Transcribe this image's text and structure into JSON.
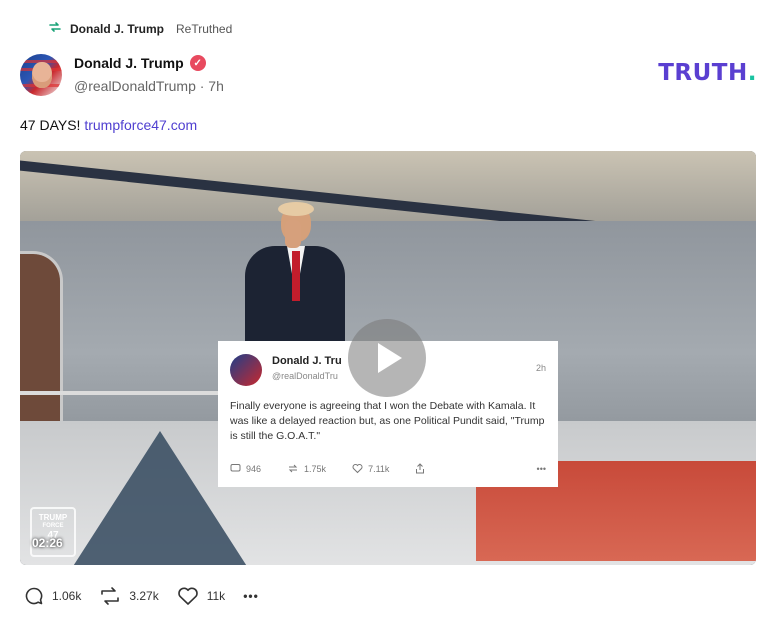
{
  "retruth": {
    "name": "Donald J. Trump",
    "label": "ReTruthed"
  },
  "author": {
    "display_name": "Donald J. Trump",
    "handle": "@realDonaldTrump · 7h"
  },
  "brand": {
    "logo_text": "TRUTH",
    "logo_dot": ".",
    "accent": "#5a3fd1",
    "dot_color": "#19c3a1"
  },
  "post": {
    "text": "47 DAYS! ",
    "link": "trumpforce47.com"
  },
  "media": {
    "duration": "02:26",
    "watermark_line1": "TRUMP",
    "watermark_line2": "FORCE",
    "watermark_line3": "47",
    "embedded_tweet": {
      "name": "Donald J. Tru",
      "handle": "@realDonaldTru",
      "time": "2h",
      "body": "Finally everyone is agreeing that I won the Debate with Kamala. It was like a delayed reaction but, as one Political Pundit said, \"Trump is still the G.O.A.T.\"",
      "replies": "946",
      "retweets": "1.75k",
      "likes": "7.11k"
    }
  },
  "actions": {
    "replies": "1.06k",
    "retruths": "3.27k",
    "likes": "11k",
    "more": "•••"
  }
}
